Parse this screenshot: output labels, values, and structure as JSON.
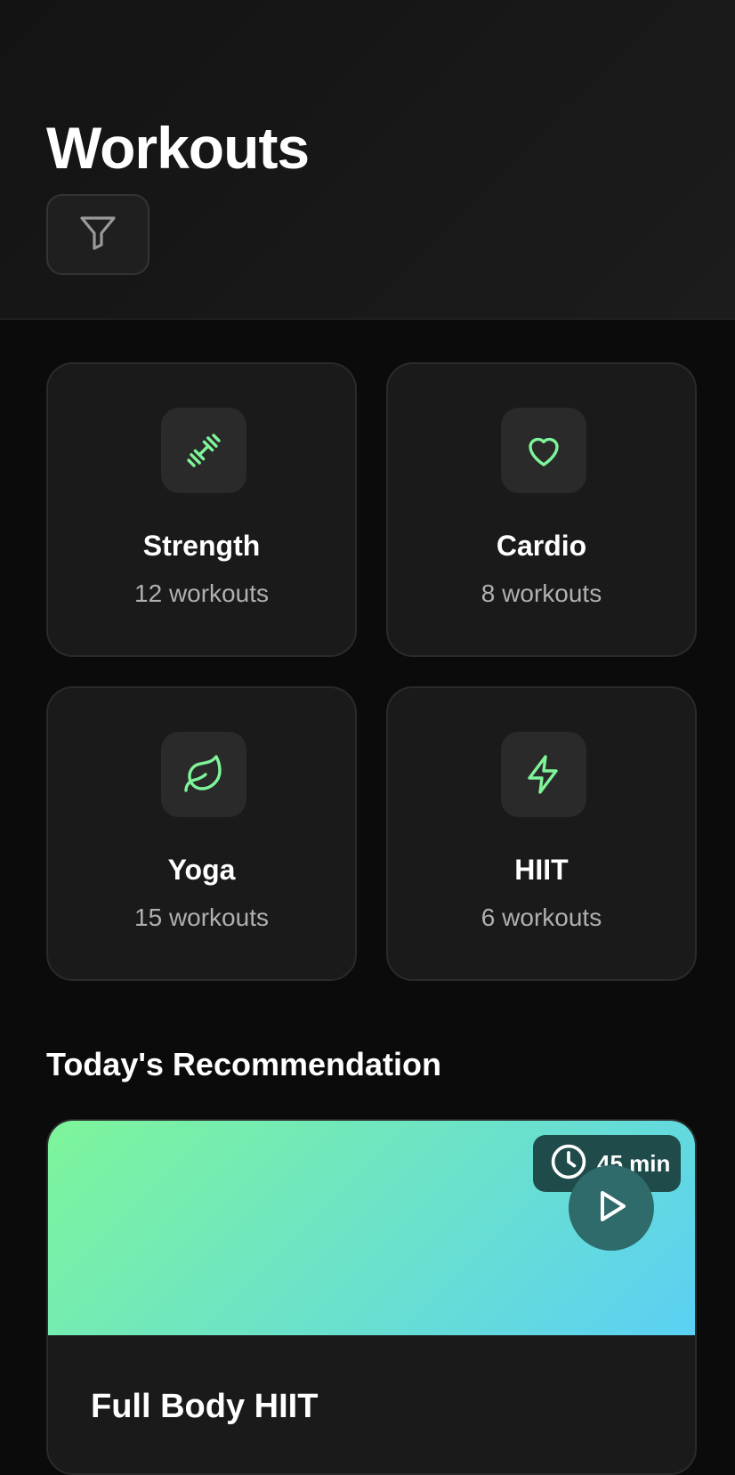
{
  "header": {
    "title": "Workouts",
    "filter_icon": "filter-icon"
  },
  "categories": [
    {
      "title": "Strength",
      "count": "12 workouts",
      "icon": "dumbbell-icon"
    },
    {
      "title": "Cardio",
      "count": "8 workouts",
      "icon": "heart-icon"
    },
    {
      "title": "Yoga",
      "count": "15 workouts",
      "icon": "leaf-icon"
    },
    {
      "title": "HIIT",
      "count": "6 workouts",
      "icon": "lightning-icon"
    }
  ],
  "recommendation": {
    "section_title": "Today's Recommendation",
    "duration": "45 min",
    "title": "Full Body HIIT",
    "icons": [
      "clock-icon",
      "play-icon"
    ]
  },
  "colors": {
    "accent": "#7ef59a",
    "gradient_end": "#5ad0f5",
    "background": "#0b0b0b",
    "card": "#1a1a1a"
  }
}
